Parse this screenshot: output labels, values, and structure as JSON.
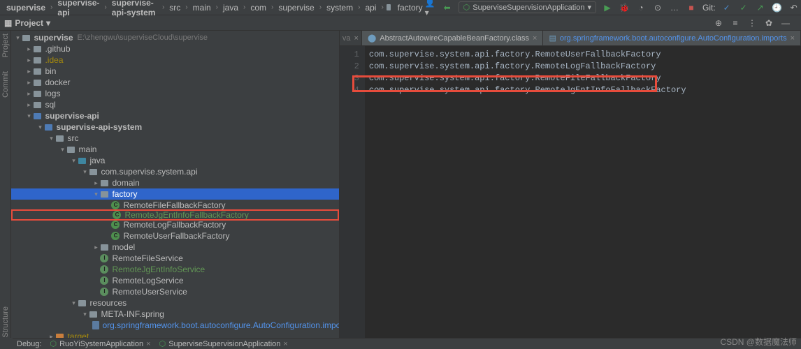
{
  "breadcrumbs": [
    "supervise",
    "supervise-api",
    "supervise-api-system",
    "src",
    "main",
    "java",
    "com",
    "supervise",
    "system",
    "api",
    "factory"
  ],
  "run_config": "SuperviseSupervisionApplication",
  "git_label": "Git:",
  "project_panel": {
    "title": "Project",
    "root": "supervise",
    "root_path": "E:\\zhengwu\\superviseCloud\\supervise"
  },
  "tree": {
    "github": ".github",
    "idea": ".idea",
    "bin": "bin",
    "docker": "docker",
    "logs": "logs",
    "sql": "sql",
    "supervise_api": "supervise-api",
    "supervise_api_system": "supervise-api-system",
    "src": "src",
    "main": "main",
    "java": "java",
    "package": "com.supervise.system.api",
    "domain": "domain",
    "factory": "factory",
    "rfff": "RemoteFileFallbackFactory",
    "rjef": "RemoteJgEntInfoFallbackFactory",
    "rlff": "RemoteLogFallbackFactory",
    "ruff": "RemoteUserFallbackFactory",
    "model": "model",
    "rfs": "RemoteFileService",
    "rjs": "RemoteJgEntInfoService",
    "rls": "RemoteLogService",
    "rus": "RemoteUserService",
    "resources": "resources",
    "meta": "META-INF.spring",
    "autoconf": "org.springframework.boot.autoconfigure.AutoConfiguration.imports",
    "target": "target"
  },
  "tabs": {
    "ext": "va",
    "t1": "AbstractAutowireCapableBeanFactory.class",
    "t2": "org.springframework.boot.autoconfigure.AutoConfiguration.imports"
  },
  "code": {
    "l1": "com.supervise.system.api.factory.RemoteUserFallbackFactory",
    "l2": "com.supervise.system.api.factory.RemoteLogFallbackFactory",
    "l3": "com.supervise.system.api.factory.RemoteFileFallbackFactory",
    "l4": "com.supervise.system.api.factory.RemoteJgEntInfoFallbackFactory"
  },
  "debug": {
    "label": "Debug:",
    "t1": "RuoYiSystemApplication",
    "t2": "SuperviseSupervisionApplication"
  },
  "sidebar_tabs": {
    "project": "Project",
    "commit": "Commit",
    "structure": "Structure"
  },
  "watermark": "CSDN @数据魔法师"
}
